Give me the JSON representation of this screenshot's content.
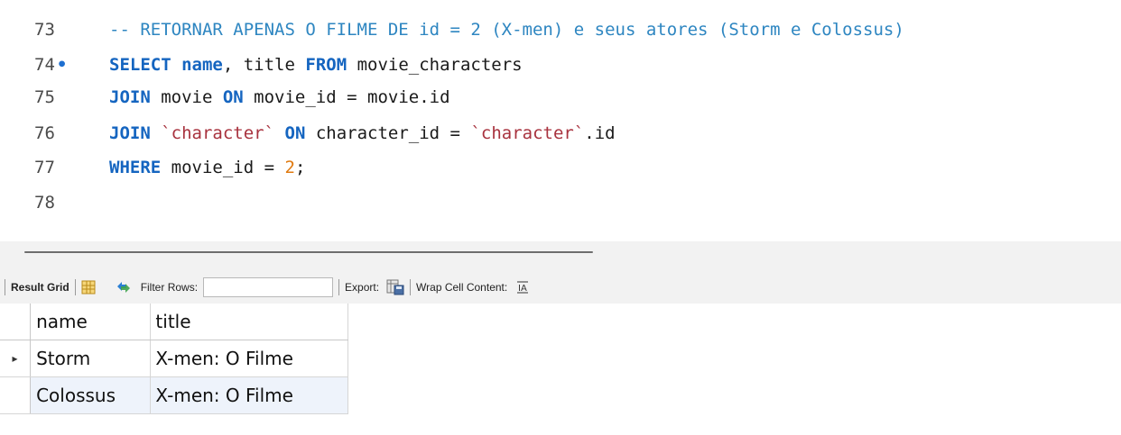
{
  "editor": {
    "lines": [
      {
        "number": "73",
        "marker": "",
        "parts": [
          {
            "t": "cmt",
            "v": "-- RETORNAR APENAS O FILME DE id = 2 (X-men) e seus atores (Storm e Colossus)"
          }
        ]
      },
      {
        "number": "74",
        "marker": "•",
        "parts": [
          {
            "t": "kw",
            "v": "SELECT"
          },
          {
            "t": "txt",
            "v": " "
          },
          {
            "t": "kw",
            "v": "name"
          },
          {
            "t": "txt",
            "v": ", title "
          },
          {
            "t": "kw",
            "v": "FROM"
          },
          {
            "t": "txt",
            "v": " movie_characters"
          }
        ]
      },
      {
        "number": "75",
        "marker": "",
        "parts": [
          {
            "t": "kw",
            "v": "JOIN"
          },
          {
            "t": "txt",
            "v": " movie "
          },
          {
            "t": "kw",
            "v": "ON"
          },
          {
            "t": "txt",
            "v": " movie_id = movie.id"
          }
        ]
      },
      {
        "number": "76",
        "marker": "",
        "parts": [
          {
            "t": "kw",
            "v": "JOIN"
          },
          {
            "t": "txt",
            "v": " "
          },
          {
            "t": "str",
            "v": "`character`"
          },
          {
            "t": "txt",
            "v": " "
          },
          {
            "t": "kw",
            "v": "ON"
          },
          {
            "t": "txt",
            "v": " character_id = "
          },
          {
            "t": "str",
            "v": "`character`"
          },
          {
            "t": "txt",
            "v": ".id"
          }
        ]
      },
      {
        "number": "77",
        "marker": "",
        "parts": [
          {
            "t": "kw",
            "v": "WHERE"
          },
          {
            "t": "txt",
            "v": " movie_id = "
          },
          {
            "t": "num",
            "v": "2"
          },
          {
            "t": "txt",
            "v": ";"
          }
        ]
      },
      {
        "number": "78",
        "marker": "",
        "parts": []
      }
    ]
  },
  "toolbar": {
    "result_grid_label": "Result Grid",
    "filter_rows_label": "Filter Rows:",
    "filter_rows_value": "",
    "export_label": "Export:",
    "wrap_label": "Wrap Cell Content:"
  },
  "grid": {
    "columns": [
      "name",
      "title"
    ],
    "rows": [
      [
        "Storm",
        "X-men: O Filme"
      ],
      [
        "Colossus",
        "X-men: O Filme"
      ]
    ],
    "current_row_marker": "▸"
  },
  "colors": {
    "keyword": "#1565c0",
    "comment": "#2e86c1",
    "string": "#a8323e",
    "number": "#e07a10"
  }
}
